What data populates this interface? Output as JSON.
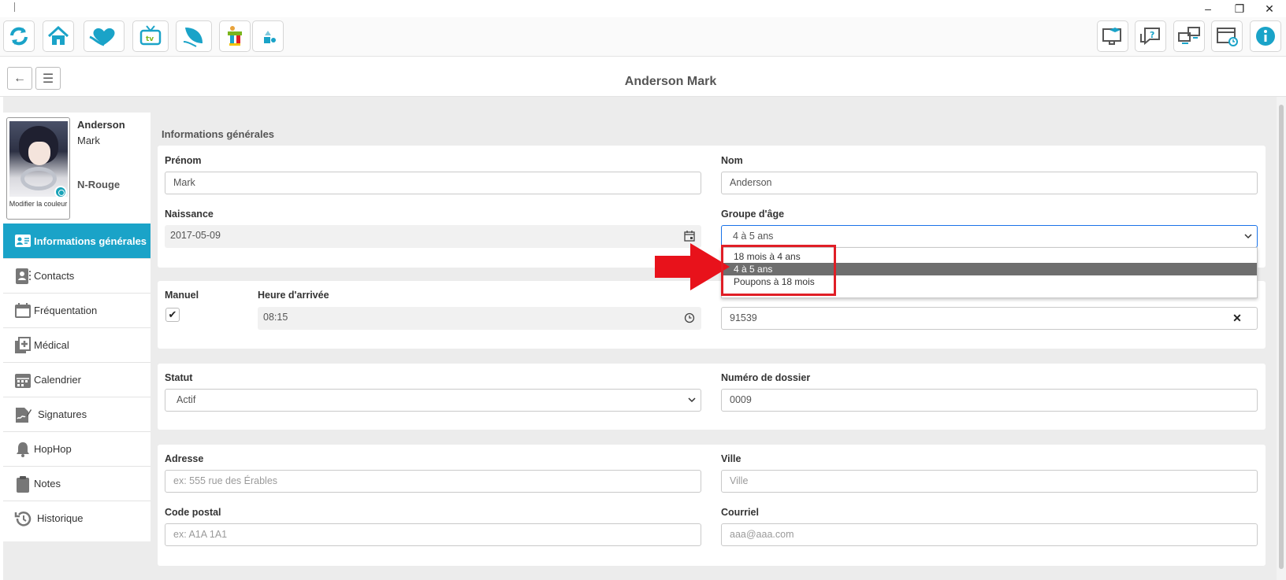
{
  "window": {
    "minimize": "–",
    "restore": "❐",
    "close": "✕"
  },
  "toolbar": {
    "left_icons": [
      "refresh-icon",
      "home-icon",
      "heart-hands-icon",
      "tv-icon",
      "leaf-hand-icon",
      "kids-icon",
      "shapes-icon"
    ],
    "right_icons": [
      "screen-cap-icon",
      "help-chat-icon",
      "screens-sync-icon",
      "calendar-clock-icon",
      "info-icon"
    ],
    "accent": "#1aa3c8"
  },
  "header": {
    "back": "←",
    "menu": "☰",
    "title": "Anderson Mark"
  },
  "profile": {
    "last_name": "Anderson",
    "first_name": "Mark",
    "group": "N-Rouge",
    "modify_color": "Modifier la couleur"
  },
  "sidebar": {
    "items": [
      {
        "label": "Informations générales",
        "icon": "id-card-icon",
        "active": true
      },
      {
        "label": "Contacts",
        "icon": "contact-icon"
      },
      {
        "label": "Fréquentation",
        "icon": "calendar-icon"
      },
      {
        "label": "Médical",
        "icon": "medical-icon"
      },
      {
        "label": "Calendrier",
        "icon": "calendar-grid-icon"
      },
      {
        "label": "Signatures",
        "icon": "signature-icon"
      },
      {
        "label": "HopHop",
        "icon": "bell-icon"
      },
      {
        "label": "Notes",
        "icon": "clipboard-icon"
      },
      {
        "label": "Historique",
        "icon": "history-icon"
      }
    ]
  },
  "form": {
    "section_title": "Informations générales",
    "prenom": {
      "label": "Prénom",
      "value": "Mark"
    },
    "nom": {
      "label": "Nom",
      "value": "Anderson"
    },
    "naissance": {
      "label": "Naissance",
      "value": "2017-05-09"
    },
    "groupe_age": {
      "label": "Groupe d'âge",
      "value": "4 à 5 ans",
      "options": [
        "18 mois à 4 ans",
        "4 à 5 ans",
        "Poupons à 18 mois"
      ]
    },
    "manuel": {
      "label": "Manuel",
      "checked": "✔"
    },
    "heure_arrivee": {
      "label": "Heure d'arrivée",
      "value": "08:15"
    },
    "code_field": {
      "value": "91539",
      "clear": "✕"
    },
    "statut": {
      "label": "Statut",
      "value": "Actif"
    },
    "numero_dossier": {
      "label": "Numéro de dossier",
      "value": "0009"
    },
    "adresse": {
      "label": "Adresse",
      "placeholder": "ex: 555 rue des Érables"
    },
    "ville": {
      "label": "Ville",
      "placeholder": "Ville"
    },
    "code_postal": {
      "label": "Code postal",
      "placeholder": "ex: A1A 1A1"
    },
    "courriel": {
      "label": "Courriel",
      "placeholder": "aaa@aaa.com"
    }
  }
}
